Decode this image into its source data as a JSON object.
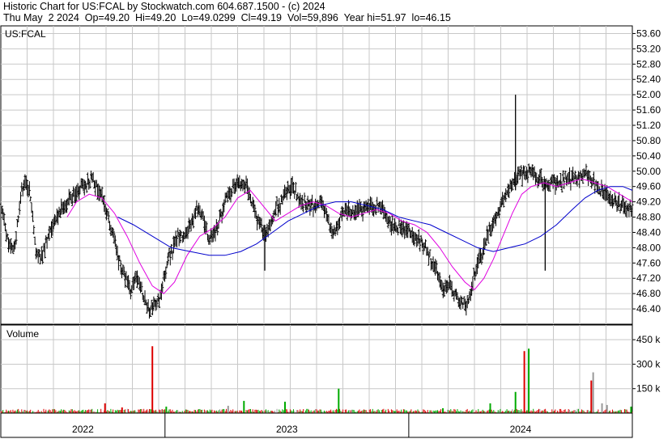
{
  "header": {
    "line1": "Historic Chart for US:FCAL by Stockwatch.com 604.687.1500 - (c) 2024",
    "line2": "Thu May  2 2024  Op=49.20  Hi=49.20  Lo=49.0299  Cl=49.19  Vol=59,896  Year hi=51.97  lo=46.15"
  },
  "colors": {
    "grid": "#c8c8c8",
    "price_bar": "#000000",
    "ma_short": "#e000e0",
    "ma_long": "#0000cc",
    "vol_up": "#00aa00",
    "vol_down": "#dd0000",
    "vol_flat": "#999999"
  },
  "chart_data": [
    {
      "type": "ohlc",
      "title": "US:FCAL",
      "y_ticks": [
        "53.60",
        "53.20",
        "52.80",
        "52.40",
        "52.00",
        "51.60",
        "51.20",
        "50.80",
        "50.40",
        "50.00",
        "49.60",
        "49.20",
        "48.80",
        "48.40",
        "48.00",
        "47.60",
        "47.20",
        "46.80",
        "46.40"
      ],
      "ylim": [
        46.0,
        53.8
      ],
      "x_labels": [
        "2022",
        "2023",
        "2024"
      ],
      "year_boundaries": [
        0.26,
        0.646
      ],
      "price_path": [
        [
          0.0,
          49.0
        ],
        [
          0.012,
          48.2
        ],
        [
          0.022,
          47.9
        ],
        [
          0.032,
          49.5
        ],
        [
          0.04,
          49.7
        ],
        [
          0.048,
          49.3
        ],
        [
          0.055,
          47.9
        ],
        [
          0.065,
          47.8
        ],
        [
          0.08,
          48.5
        ],
        [
          0.09,
          48.8
        ],
        [
          0.1,
          49.1
        ],
        [
          0.115,
          49.4
        ],
        [
          0.128,
          49.6
        ],
        [
          0.145,
          49.8
        ],
        [
          0.16,
          49.3
        ],
        [
          0.175,
          48.5
        ],
        [
          0.19,
          47.5
        ],
        [
          0.205,
          46.9
        ],
        [
          0.215,
          47.3
        ],
        [
          0.225,
          46.8
        ],
        [
          0.235,
          46.3
        ],
        [
          0.25,
          46.6
        ],
        [
          0.265,
          47.7
        ],
        [
          0.28,
          48.3
        ],
        [
          0.295,
          48.4
        ],
        [
          0.31,
          49.0
        ],
        [
          0.32,
          48.9
        ],
        [
          0.33,
          48.1
        ],
        [
          0.345,
          48.7
        ],
        [
          0.36,
          49.4
        ],
        [
          0.375,
          49.8
        ],
        [
          0.39,
          49.6
        ],
        [
          0.405,
          48.8
        ],
        [
          0.42,
          48.3
        ],
        [
          0.435,
          49.0
        ],
        [
          0.45,
          49.4
        ],
        [
          0.46,
          49.6
        ],
        [
          0.475,
          49.2
        ],
        [
          0.495,
          49.1
        ],
        [
          0.51,
          49.2
        ],
        [
          0.525,
          48.3
        ],
        [
          0.54,
          48.9
        ],
        [
          0.555,
          49.0
        ],
        [
          0.57,
          49.0
        ],
        [
          0.59,
          49.1
        ],
        [
          0.605,
          49.0
        ],
        [
          0.62,
          48.6
        ],
        [
          0.64,
          48.5
        ],
        [
          0.655,
          48.3
        ],
        [
          0.67,
          48.1
        ],
        [
          0.685,
          47.6
        ],
        [
          0.7,
          46.9
        ],
        [
          0.712,
          47.0
        ],
        [
          0.725,
          46.6
        ],
        [
          0.738,
          46.5
        ],
        [
          0.75,
          47.3
        ],
        [
          0.762,
          47.9
        ],
        [
          0.775,
          48.5
        ],
        [
          0.788,
          49.0
        ],
        [
          0.8,
          49.4
        ],
        [
          0.812,
          49.8
        ],
        [
          0.825,
          49.9
        ],
        [
          0.838,
          50.0
        ],
        [
          0.85,
          49.8
        ],
        [
          0.862,
          49.7
        ],
        [
          0.878,
          49.7
        ],
        [
          0.895,
          49.8
        ],
        [
          0.91,
          49.8
        ],
        [
          0.925,
          49.9
        ],
        [
          0.938,
          49.7
        ],
        [
          0.95,
          49.5
        ],
        [
          0.965,
          49.3
        ],
        [
          0.98,
          49.1
        ],
        [
          1.0,
          49.0
        ]
      ],
      "series": [
        {
          "kind": "ma_short",
          "points": [
            [
              0.105,
              48.8
            ],
            [
              0.12,
              49.2
            ],
            [
              0.14,
              49.4
            ],
            [
              0.16,
              49.3
            ],
            [
              0.18,
              48.9
            ],
            [
              0.2,
              48.3
            ],
            [
              0.22,
              47.6
            ],
            [
              0.24,
              47.0
            ],
            [
              0.258,
              46.8
            ],
            [
              0.275,
              47.1
            ],
            [
              0.295,
              47.8
            ],
            [
              0.315,
              48.3
            ],
            [
              0.335,
              48.5
            ],
            [
              0.355,
              48.8
            ],
            [
              0.375,
              49.3
            ],
            [
              0.395,
              49.5
            ],
            [
              0.415,
              49.1
            ],
            [
              0.435,
              48.7
            ],
            [
              0.455,
              48.9
            ],
            [
              0.475,
              49.1
            ],
            [
              0.495,
              49.2
            ],
            [
              0.515,
              49.1
            ],
            [
              0.535,
              48.9
            ],
            [
              0.555,
              48.8
            ],
            [
              0.575,
              48.9
            ],
            [
              0.595,
              49.0
            ],
            [
              0.615,
              48.9
            ],
            [
              0.635,
              48.7
            ],
            [
              0.655,
              48.6
            ],
            [
              0.675,
              48.4
            ],
            [
              0.695,
              48.0
            ],
            [
              0.715,
              47.5
            ],
            [
              0.735,
              47.1
            ],
            [
              0.75,
              46.9
            ],
            [
              0.765,
              47.2
            ],
            [
              0.78,
              47.7
            ],
            [
              0.795,
              48.3
            ],
            [
              0.81,
              48.9
            ],
            [
              0.825,
              49.4
            ],
            [
              0.84,
              49.6
            ],
            [
              0.86,
              49.7
            ],
            [
              0.88,
              49.6
            ],
            [
              0.9,
              49.7
            ],
            [
              0.92,
              49.8
            ],
            [
              0.94,
              49.7
            ],
            [
              0.96,
              49.6
            ],
            [
              0.98,
              49.4
            ],
            [
              1.0,
              49.2
            ]
          ]
        },
        {
          "kind": "ma_long",
          "points": [
            [
              0.185,
              48.8
            ],
            [
              0.21,
              48.6
            ],
            [
              0.24,
              48.3
            ],
            [
              0.27,
              48.0
            ],
            [
              0.3,
              47.9
            ],
            [
              0.33,
              47.8
            ],
            [
              0.355,
              47.8
            ],
            [
              0.38,
              47.9
            ],
            [
              0.405,
              48.1
            ],
            [
              0.43,
              48.4
            ],
            [
              0.455,
              48.7
            ],
            [
              0.48,
              48.9
            ],
            [
              0.505,
              49.1
            ],
            [
              0.53,
              49.2
            ],
            [
              0.555,
              49.2
            ],
            [
              0.58,
              49.1
            ],
            [
              0.605,
              49.0
            ],
            [
              0.63,
              48.8
            ],
            [
              0.655,
              48.7
            ],
            [
              0.68,
              48.6
            ],
            [
              0.705,
              48.4
            ],
            [
              0.73,
              48.2
            ],
            [
              0.755,
              48.0
            ],
            [
              0.78,
              47.9
            ],
            [
              0.805,
              48.0
            ],
            [
              0.83,
              48.1
            ],
            [
              0.855,
              48.3
            ],
            [
              0.88,
              48.6
            ],
            [
              0.905,
              49.0
            ],
            [
              0.925,
              49.3
            ],
            [
              0.945,
              49.5
            ],
            [
              0.965,
              49.6
            ],
            [
              0.985,
              49.6
            ],
            [
              1.0,
              49.5
            ]
          ]
        }
      ],
      "spikes": [
        {
          "x": 0.418,
          "low": 47.4,
          "high": 48.6
        },
        {
          "x": 0.815,
          "low": 49.5,
          "high": 52.0
        },
        {
          "x": 0.862,
          "low": 47.4,
          "high": 49.8
        }
      ]
    },
    {
      "type": "bar",
      "title": "Volume",
      "y_ticks": [
        "450 k",
        "300 k",
        "150 k"
      ],
      "ylim": [
        0,
        540
      ],
      "spikes": [
        {
          "x": 0.165,
          "value": 60,
          "color": "down"
        },
        {
          "x": 0.192,
          "value": 35,
          "color": "down"
        },
        {
          "x": 0.24,
          "value": 410,
          "color": "down"
        },
        {
          "x": 0.262,
          "value": 40,
          "color": "up"
        },
        {
          "x": 0.36,
          "value": 45,
          "color": "flat"
        },
        {
          "x": 0.385,
          "value": 75,
          "color": "up"
        },
        {
          "x": 0.45,
          "value": 70,
          "color": "up"
        },
        {
          "x": 0.535,
          "value": 150,
          "color": "up"
        },
        {
          "x": 0.7,
          "value": 30,
          "color": "up"
        },
        {
          "x": 0.775,
          "value": 60,
          "color": "up"
        },
        {
          "x": 0.815,
          "value": 130,
          "color": "up"
        },
        {
          "x": 0.829,
          "value": 380,
          "color": "down"
        },
        {
          "x": 0.836,
          "value": 395,
          "color": "up"
        },
        {
          "x": 0.935,
          "value": 200,
          "color": "down"
        },
        {
          "x": 0.938,
          "value": 250,
          "color": "flat"
        },
        {
          "x": 0.952,
          "value": 60,
          "color": "flat"
        },
        {
          "x": 0.96,
          "value": 50,
          "color": "flat"
        },
        {
          "x": 0.998,
          "value": 40,
          "color": "up"
        }
      ]
    }
  ]
}
